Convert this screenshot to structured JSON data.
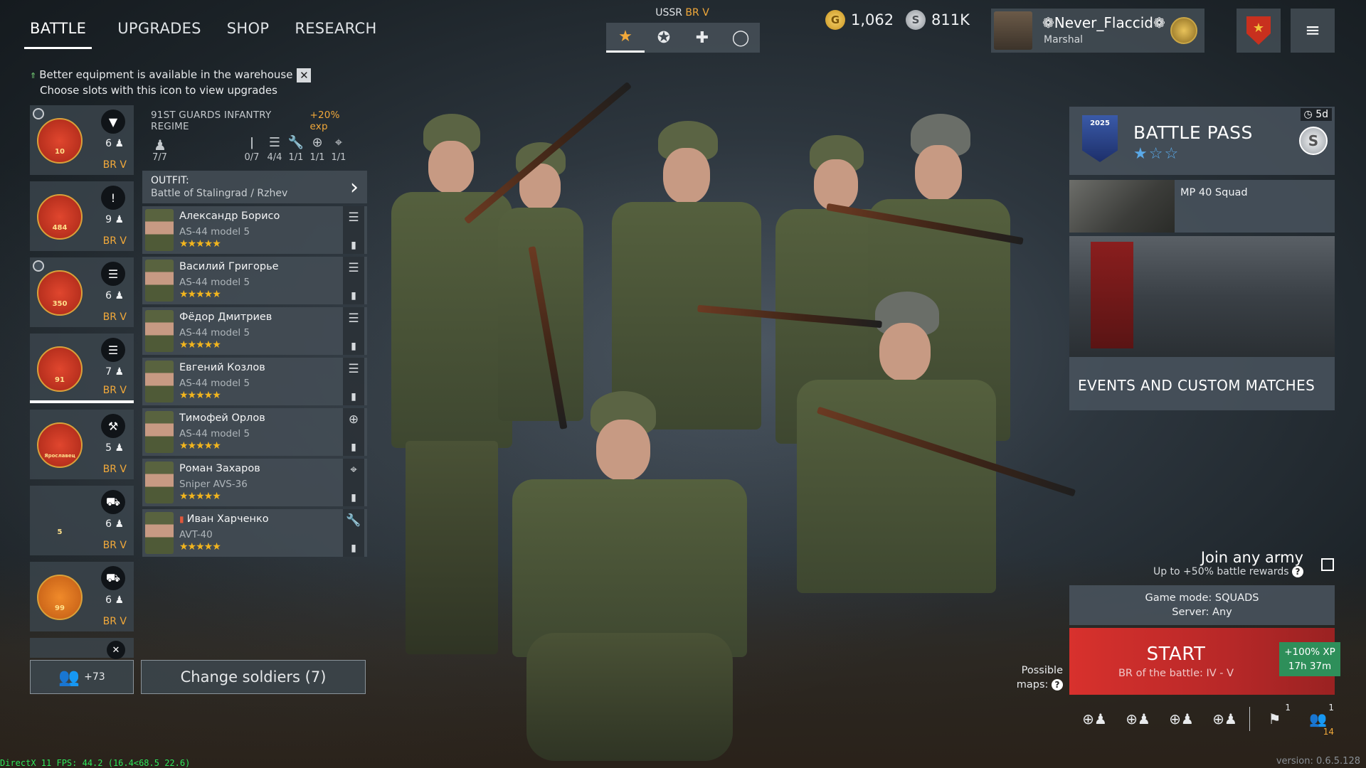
{
  "nav": {
    "tabs": [
      "BATTLE",
      "UPGRADES",
      "SHOP",
      "RESEARCH"
    ]
  },
  "notice": {
    "line1": "Better equipment is available in the warehouse",
    "line2": "Choose slots with this icon to view upgrades",
    "close": "✕"
  },
  "squads": [
    {
      "count": "6",
      "br": "BR V",
      "emblem_num": "10",
      "class_icon": "paratrooper-icon"
    },
    {
      "count": "9",
      "br": "BR V",
      "emblem_num": "484",
      "class_icon": "exclamation-icon"
    },
    {
      "count": "6",
      "br": "BR V",
      "emblem_num": "350",
      "class_icon": "list-icon"
    },
    {
      "count": "7",
      "br": "BR V",
      "emblem_num": "91",
      "class_icon": "list-icon"
    },
    {
      "count": "5",
      "br": "BR V",
      "emblem_num": "Ярославец",
      "class_icon": "engineer-icon"
    },
    {
      "count": "6",
      "br": "BR V",
      "emblem_num": "5",
      "class_icon": "vehicle-icon"
    },
    {
      "count": "6",
      "br": "BR V",
      "emblem_num": "99",
      "class_icon": "tank-icon"
    }
  ],
  "recruits": {
    "count": "+73"
  },
  "change_soldiers": "Change soldiers (7)",
  "regiment": {
    "name": "91ST GUARDS INFANTRY REGIME",
    "bonus": "+20% exp",
    "soldiers": "7/7",
    "eq1": "0/7",
    "eq2": "4/4",
    "eq3": "1/1",
    "eq4": "1/1",
    "eq5": "1/1"
  },
  "outfit": {
    "label": "OUTFIT:",
    "value": "Battle of Stalingrad / Rzhev"
  },
  "soldiers": [
    {
      "name": "Александр Борисо",
      "weapon": "AS-44 model 5",
      "stars": "★★★★★"
    },
    {
      "name": "Василий Григорье",
      "weapon": "AS-44 model 5",
      "stars": "★★★★★"
    },
    {
      "name": "Фёдор Дмитриев",
      "weapon": "AS-44 model 5",
      "stars": "★★★★★"
    },
    {
      "name": "Евгений Козлов",
      "weapon": "AS-44 model 5",
      "stars": "★★★★★"
    },
    {
      "name": "Тимофей Орлов",
      "weapon": "AS-44 model 5",
      "stars": "★★★★★"
    },
    {
      "name": "Роман Захаров",
      "weapon": "Sniper AVS-36",
      "stars": "★★★★★"
    },
    {
      "name": "Иван Харченко",
      "weapon": "AVT-40",
      "stars": "★★★★★"
    }
  ],
  "nation": {
    "name": "USSR",
    "br": "BR V"
  },
  "currency": {
    "gold": "1,062",
    "silver": "811K",
    "gold_symbol": "G",
    "silver_symbol": "S"
  },
  "profile": {
    "name": "❁Never_Flaccid❁",
    "rank": "Marshal"
  },
  "battle_pass": {
    "title": "BATTLE PASS",
    "stars": "★☆☆",
    "timer": "5d",
    "logo_year": "2025",
    "coin": "S"
  },
  "mp40": {
    "label": "MP 40 Squad"
  },
  "events": {
    "label": "EVENTS AND CUSTOM MATCHES"
  },
  "join": {
    "title": "Join any army",
    "subtitle": "Up to +50% battle rewards",
    "q": "?"
  },
  "game_mode": {
    "mode": "Game mode: SQUADS",
    "server": "Server: Any"
  },
  "start": {
    "label": "START",
    "br": "BR of the battle: IV - V",
    "xp": "+100% XP",
    "xp_time": "17h 37m"
  },
  "maps": {
    "line1": "Possible",
    "line2": "maps:",
    "q": "?"
  },
  "bottom": {
    "flag_count": "1",
    "group_count": "1",
    "online": "14"
  },
  "debug": "DirectX 11 FPS: 44.2 (16.4<68.5 22.6)",
  "version": "version: 0.6.5.128",
  "colors": {
    "accent_orange": "#f2a93a",
    "start_red": "#d8312d",
    "xp_green": "#2e8f5a",
    "star_gold": "#f2b51e"
  }
}
